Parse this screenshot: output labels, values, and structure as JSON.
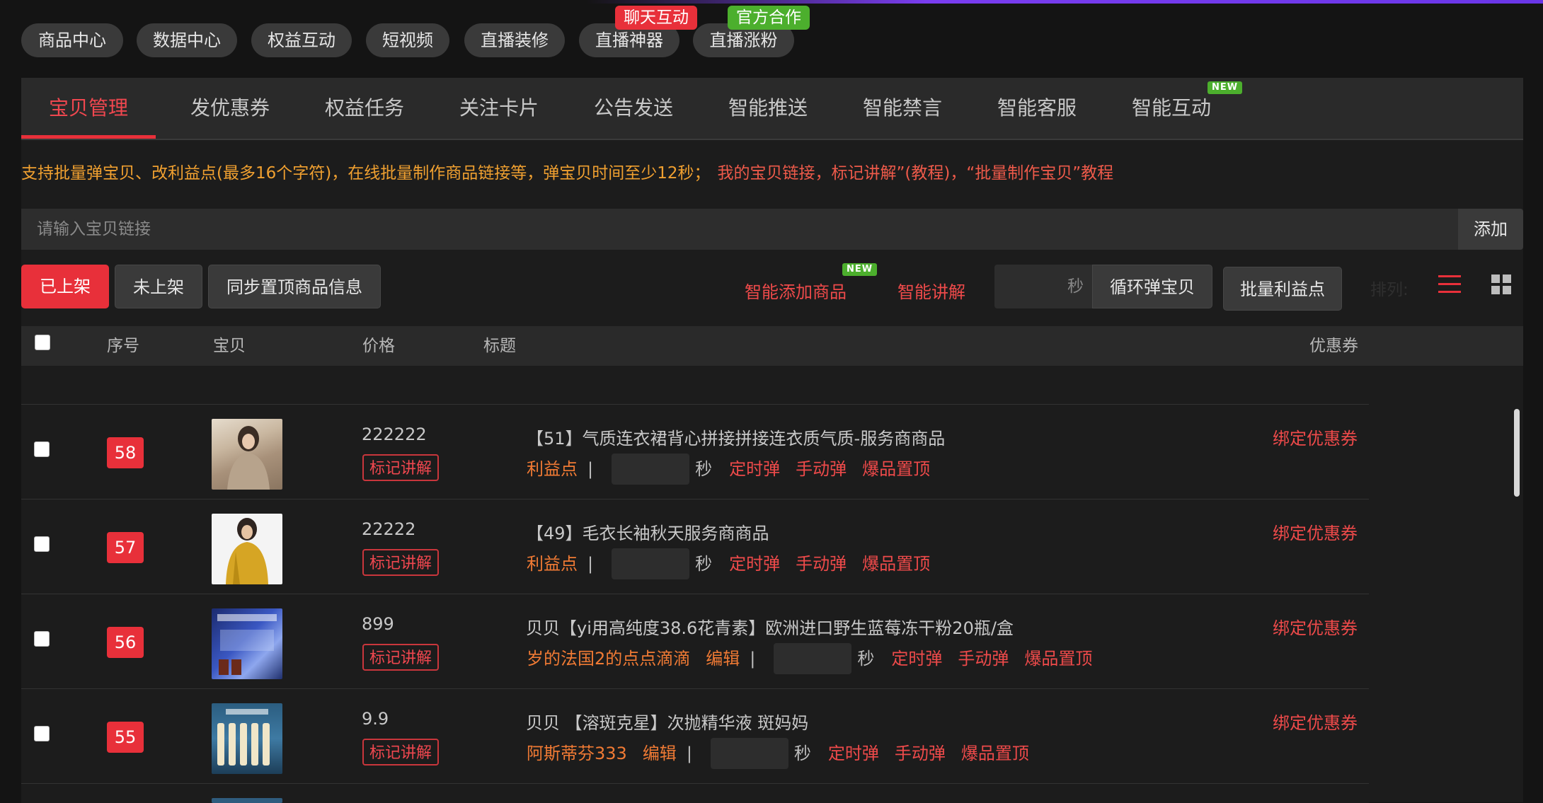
{
  "top_nav": {
    "pills": [
      "商品中心",
      "数据中心",
      "权益互动",
      "短视频",
      "直播装修",
      "直播神器",
      "直播涨粉"
    ],
    "badges": [
      "聊天互动",
      "官方合作"
    ]
  },
  "tabs": {
    "items": [
      "宝贝管理",
      "发优惠券",
      "权益任务",
      "关注卡片",
      "公告发送",
      "智能推送",
      "智能禁言",
      "智能客服",
      "智能互动"
    ],
    "new_badge": "NEW"
  },
  "notice": {
    "orange_text": "支持批量弹宝贝、改利益点(最多16个字符)，在线批量制作商品链接等，弹宝贝时间至少12秒；",
    "red_text": "我的宝贝链接，标记讲解”(教程)，“批量制作宝贝”教程"
  },
  "link_input": {
    "placeholder": "请输入宝贝链接",
    "add_label": "添加"
  },
  "toolbar": {
    "listed": "已上架",
    "unlisted": "未上架",
    "sync": "同步置顶商品信息",
    "smart_add": "智能添加商品",
    "smart_add_badge": "NEW",
    "smart_explain": "智能讲解",
    "sec_unit": "秒",
    "loop_pop": "循环弹宝贝",
    "batch_benefit": "批量利益点",
    "sort_label": "排列:"
  },
  "table": {
    "headers": {
      "index": "序号",
      "item": "宝贝",
      "price": "价格",
      "title": "标题",
      "coupon": "优惠券"
    },
    "mark_label": "标记讲解",
    "bind_label": "绑定优惠券",
    "sec_unit": "秒",
    "edit_label": "编辑",
    "timed_label": "定时弹",
    "manual_label": "手动弹",
    "top_label": "爆品置顶",
    "rows": [
      {
        "index": "58",
        "price": "222222",
        "title": "【51】气质连衣裙背心拼接拼接连衣质气质-服务商商品",
        "benefit": "利益点",
        "editable": false
      },
      {
        "index": "57",
        "price": "22222",
        "title": "【49】毛衣长袖秋天服务商商品",
        "benefit": "利益点",
        "editable": false
      },
      {
        "index": "56",
        "price": "899",
        "title": "贝贝【yi用高纯度38.6花青素】欧洲进口野生蓝莓冻干粉20瓶/盒",
        "benefit": "岁的法国2的点点滴滴",
        "editable": true
      },
      {
        "index": "55",
        "price": "9.9",
        "title": "贝贝 【溶斑克星】次抛精华液 斑妈妈",
        "benefit": "阿斯蒂芬333",
        "editable": true
      }
    ]
  },
  "colors": {
    "accent": "#e8303a",
    "orange": "#f07a34",
    "background": "#141414"
  }
}
